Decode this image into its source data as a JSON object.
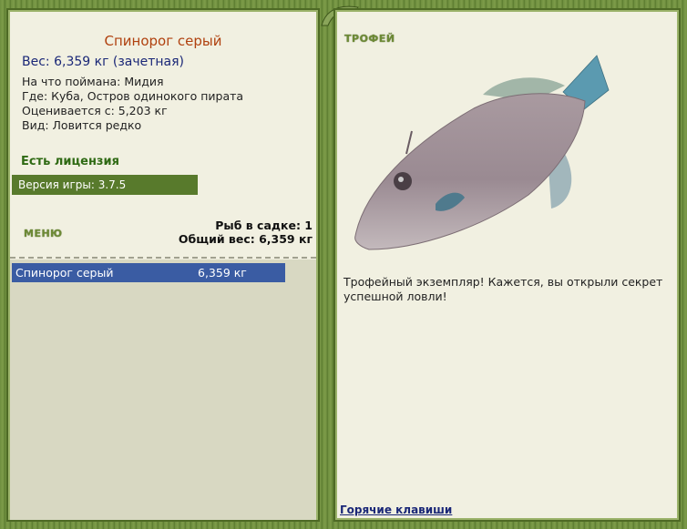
{
  "left": {
    "title": "Спинорог серый",
    "weight": "Вес: 6,359 кг (зачетная)",
    "info": [
      "На что поймана: Мидия",
      "Где: Куба, Остров одинокого пирата",
      "Оценивается с: 5,203 кг",
      "Вид: Ловится редко"
    ],
    "license": "Есть лицензия",
    "version": "Версия игры: 3.7.5",
    "menu_label": "МЕНЮ",
    "keepnet_count": "Рыб в садке: 1",
    "keepnet_total": "Общий вес: 6,359 кг",
    "list": [
      {
        "name": "Спинорог серый",
        "weight": "6,359 кг"
      }
    ]
  },
  "right": {
    "trophy_label": "ТРОФЕЙ",
    "fish_image_icon": "triggerfish-photo",
    "message": "Трофейный экземпляр! Кажется, вы открыли секрет успешной ловли!",
    "hotkeys_label": "Горячие клавиши"
  }
}
